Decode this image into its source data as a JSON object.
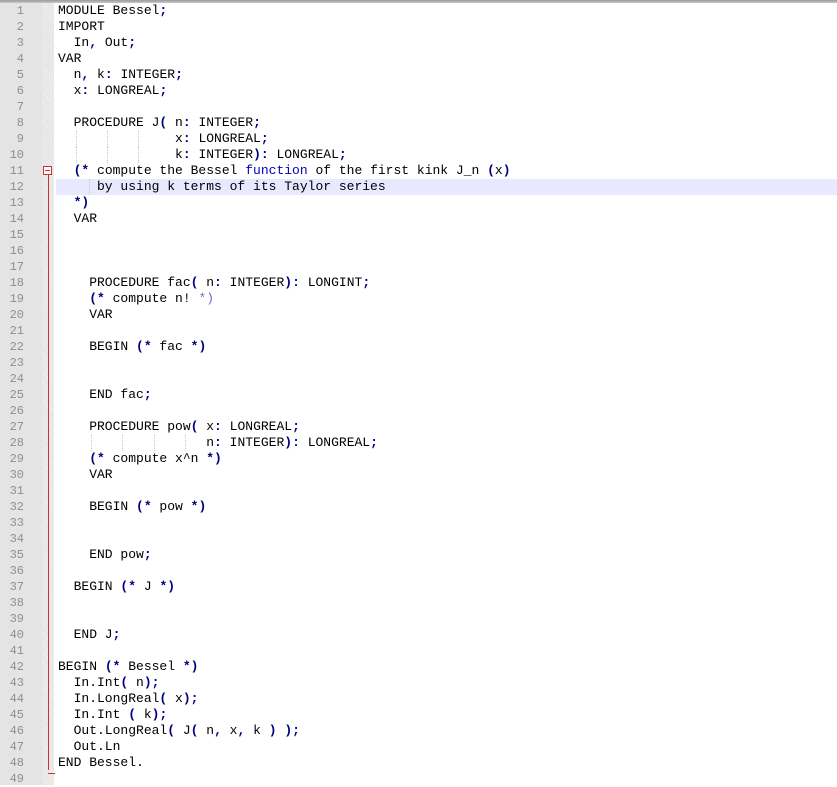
{
  "editor": {
    "current_line": 12,
    "fold_start_line": 11,
    "fold_end_line": 48,
    "colors": {
      "current_line_bg": "#e8e8ff",
      "fold_marker": "#c83232",
      "gutter_bg": "#e4e4e4",
      "line_number": "#8f8f8f",
      "operator": "#000080",
      "keyword_function": "#0000c0"
    },
    "lines": [
      {
        "n": "1",
        "text": "MODULE Bessel;"
      },
      {
        "n": "2",
        "text": "IMPORT"
      },
      {
        "n": "3",
        "text": "  In, Out;"
      },
      {
        "n": "4",
        "text": "VAR"
      },
      {
        "n": "5",
        "text": "  n, k: INTEGER;"
      },
      {
        "n": "6",
        "text": "  x: LONGREAL;"
      },
      {
        "n": "7",
        "text": ""
      },
      {
        "n": "8",
        "text": "  PROCEDURE J( n: INTEGER;"
      },
      {
        "n": "9",
        "text": "               x: LONGREAL;"
      },
      {
        "n": "10",
        "text": "               k: INTEGER): LONGREAL;"
      },
      {
        "n": "11",
        "text": "  (* compute the Bessel function of the first kink J_n (x)"
      },
      {
        "n": "12",
        "text": "     by using k terms of its Taylor series"
      },
      {
        "n": "13",
        "text": "  *)"
      },
      {
        "n": "14",
        "text": "  VAR"
      },
      {
        "n": "15",
        "text": ""
      },
      {
        "n": "16",
        "text": ""
      },
      {
        "n": "17",
        "text": ""
      },
      {
        "n": "18",
        "text": "    PROCEDURE fac( n: INTEGER): LONGINT;"
      },
      {
        "n": "19",
        "text": "    (* compute n! *)"
      },
      {
        "n": "20",
        "text": "    VAR"
      },
      {
        "n": "21",
        "text": ""
      },
      {
        "n": "22",
        "text": "    BEGIN (* fac *)"
      },
      {
        "n": "23",
        "text": ""
      },
      {
        "n": "24",
        "text": ""
      },
      {
        "n": "25",
        "text": "    END fac;"
      },
      {
        "n": "26",
        "text": ""
      },
      {
        "n": "27",
        "text": "    PROCEDURE pow( x: LONGREAL;"
      },
      {
        "n": "28",
        "text": "                   n: INTEGER): LONGREAL;"
      },
      {
        "n": "29",
        "text": "    (* compute x^n *)"
      },
      {
        "n": "30",
        "text": "    VAR"
      },
      {
        "n": "31",
        "text": ""
      },
      {
        "n": "32",
        "text": "    BEGIN (* pow *)"
      },
      {
        "n": "33",
        "text": ""
      },
      {
        "n": "34",
        "text": ""
      },
      {
        "n": "35",
        "text": "    END pow;"
      },
      {
        "n": "36",
        "text": ""
      },
      {
        "n": "37",
        "text": "  BEGIN (* J *)"
      },
      {
        "n": "38",
        "text": ""
      },
      {
        "n": "39",
        "text": ""
      },
      {
        "n": "40",
        "text": "  END J;"
      },
      {
        "n": "41",
        "text": ""
      },
      {
        "n": "42",
        "text": "BEGIN (* Bessel *)"
      },
      {
        "n": "43",
        "text": "  In.Int( n);"
      },
      {
        "n": "44",
        "text": "  In.LongReal( x);"
      },
      {
        "n": "45",
        "text": "  In.Int ( k);"
      },
      {
        "n": "46",
        "text": "  Out.LongReal( J( n, x, k ) );"
      },
      {
        "n": "47",
        "text": "  Out.Ln"
      },
      {
        "n": "48",
        "text": "END Bessel."
      },
      {
        "n": "49",
        "text": ""
      }
    ]
  }
}
